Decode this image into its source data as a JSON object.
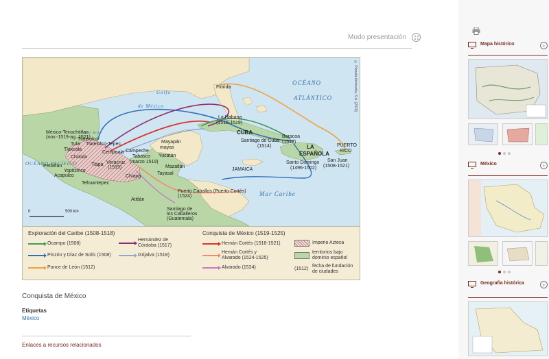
{
  "header": {
    "present_label": "Modo presentación"
  },
  "map": {
    "credit": "© Planeta Actimedia, S.A. [2018]",
    "seas": {
      "atlantic_1": "OCÉANO",
      "atlantic_2": "ATLÁNTICO",
      "gulf_1": "Golfo",
      "gulf_2": "de México",
      "caribbean": "Mar Caribe",
      "pacific": "OCÉANO PACÍFICO",
      "rio_rojo": "Río Rojo"
    },
    "places": {
      "florida": "Florida",
      "cuba": "CUBA",
      "la_habana": "La Habana",
      "la_habana_date": "(1515-1519)",
      "santiago": "Santiago de Cuba",
      "santiago_date": "(1514)",
      "baracoa": "Baracoa",
      "baracoa_date": "(1512)",
      "espanola_1": "LA",
      "espanola_2": "ESPAÑOLA",
      "santo_domingo": "Santo Domingo",
      "santo_domingo_date": "(1496-1502)",
      "puerto_rico_1": "PUERTO",
      "puerto_rico_2": "RICO",
      "san_juan": "San Juan",
      "san_juan_date": "(1508-1521)",
      "jamaica": "JAMAICA",
      "tenochtitlan": "México-Tenochtitlan",
      "tenochtitlan_date": "(nov.-1519-ag. 1521)",
      "tula": "Tula",
      "tlaxcala": "Tlaxcala",
      "cholula": "Cholula",
      "tlatelolco": "Tlatelolco",
      "tlatelolco_2": "Tlatelolco-Tepec",
      "cempoala": "Cempoala",
      "tlapa": "Tlapa",
      "veracruz": "Veracruz",
      "veracruz_date": "(1519)",
      "petlatlan": "Petlatlán",
      "yopitzinco": "Yopitzinco",
      "acapulco": "Acapulco",
      "tehuantepec": "Tehuantepec",
      "campeche": "Campeche",
      "tabasco": "Tabasco",
      "tabasco_date": "(marzo 1519)",
      "mayapan": "Mayapán",
      "mayas": "mayas",
      "yucatan": "Yucatán",
      "mazatlan": "Mazatlán",
      "tayasal": "Tayasal",
      "chiapa": "Chiapa",
      "atitlan": "Atitlán",
      "puerto_caballos": "Puerto Caballos (Puerto Cortés)",
      "puerto_caballos_date": "(1524)",
      "santiago_caballeros": "Santiago de",
      "santiago_caballeros_2": "los Caballeros",
      "santiago_caballeros_3": "(Guatemala)"
    },
    "scale_min": "0",
    "scale_max": "500 km"
  },
  "legend": {
    "exploration_title": "Exploración del Caribe (1508-1518)",
    "conquest_title": "Conquista de México (1519-1525)",
    "exploration": [
      {
        "label": "Ocampo (1508)",
        "color": "#3e9b5d"
      },
      {
        "label": "Pinzón y Díaz de Solís (1508)",
        "color": "#2e6fb8"
      },
      {
        "label": "Ponce de León (1512)",
        "color": "#f0a33b"
      },
      {
        "label": "Hernández de Córdoba (1517)",
        "color": "#8d2f6f"
      },
      {
        "label": "Grijalva (1518)",
        "color": "#8aa9cf"
      }
    ],
    "conquest": [
      {
        "label": "Hernán Cortés (1518-1521)",
        "color": "#d8342d"
      },
      {
        "label": "Hernán Cortés y Alvarado (1524-1525)",
        "color": "#f08a6a"
      },
      {
        "label": "Alvarado (1524)",
        "color": "#c57bc4"
      }
    ],
    "areas": [
      {
        "label": "Imperio Azteca"
      },
      {
        "label": "territorios bajo dominio español"
      }
    ],
    "foundation_num": "(1512)",
    "foundation_label": "fecha de fundación de ciudades"
  },
  "content": {
    "caption": "Conquista de México",
    "tags_title": "Etiquetas",
    "tag": "México",
    "related": "Enlaces a recursos relacionados"
  },
  "sidebar": {
    "panels": [
      {
        "title": "Mapa histórico"
      },
      {
        "title": "México"
      },
      {
        "title": "Geografía histórica"
      }
    ]
  },
  "colors": {
    "accent": "#7a2a1e",
    "link": "#2d6fb5",
    "sea": "#cfe6f2",
    "land": "#f3e9c9"
  }
}
